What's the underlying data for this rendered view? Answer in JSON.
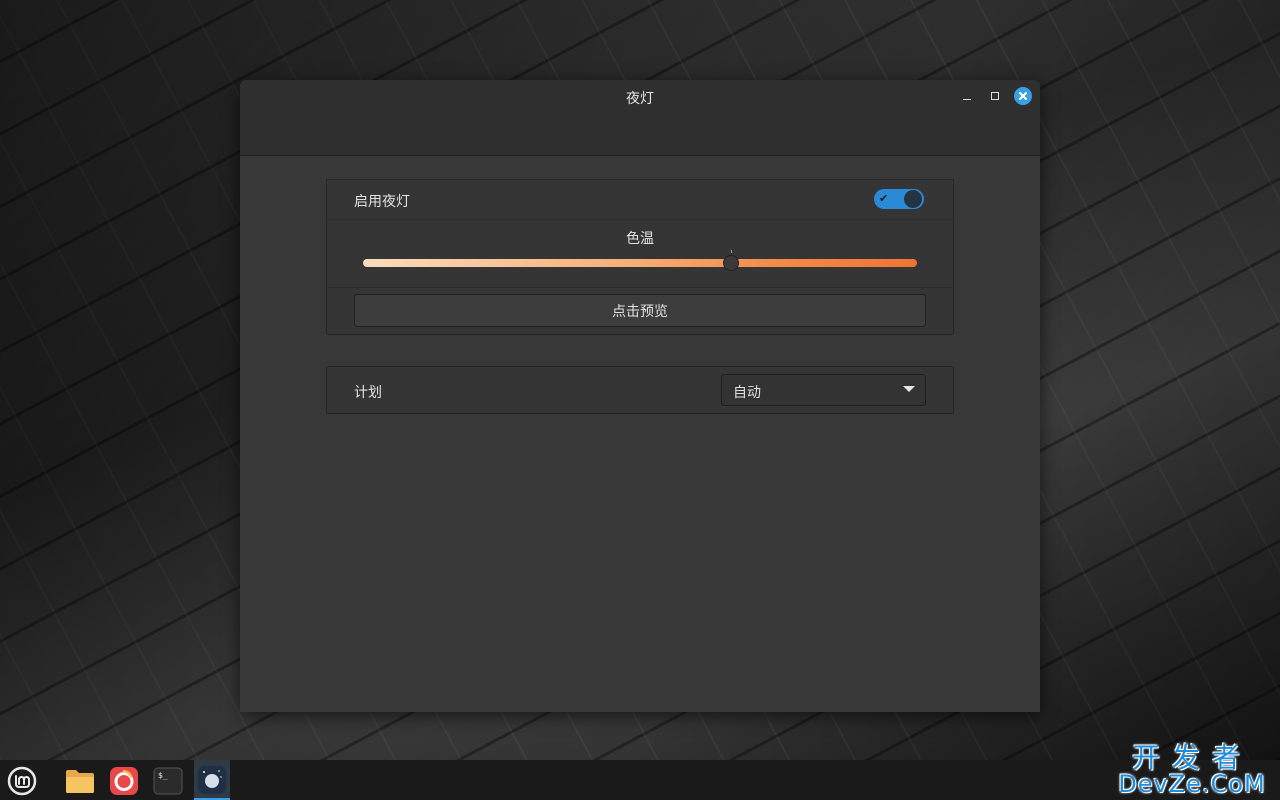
{
  "window": {
    "title": "夜灯",
    "controls": {
      "minimize_icon": "minimize-icon",
      "maximize_icon": "maximize-icon",
      "close_icon": "close-icon",
      "close_color": "#3aa0e2"
    }
  },
  "night_light": {
    "enable_label": "启用夜灯",
    "enabled": true,
    "switch_color": "#2a8ad6",
    "color_temp_label": "色温",
    "color_temp_level": 0.665,
    "gradient_colors": [
      "#fbdcbc",
      "#ef7433"
    ],
    "preview_button_label": "点击预览"
  },
  "schedule": {
    "label": "计划",
    "selected": "自动"
  },
  "taskbar": {
    "items": [
      {
        "name": "Mint menu",
        "icon": "mint-menu-icon"
      },
      {
        "name": "Files",
        "icon": "folder-icon"
      },
      {
        "name": "Firefox",
        "icon": "firefox-icon"
      },
      {
        "name": "Terminal",
        "icon": "terminal-icon"
      },
      {
        "name": "Night light",
        "icon": "night-light-icon",
        "active": true
      }
    ],
    "accent": "#3aa0e2"
  },
  "watermark": {
    "top": "开发者",
    "bottom": "DevZe.CoM"
  }
}
